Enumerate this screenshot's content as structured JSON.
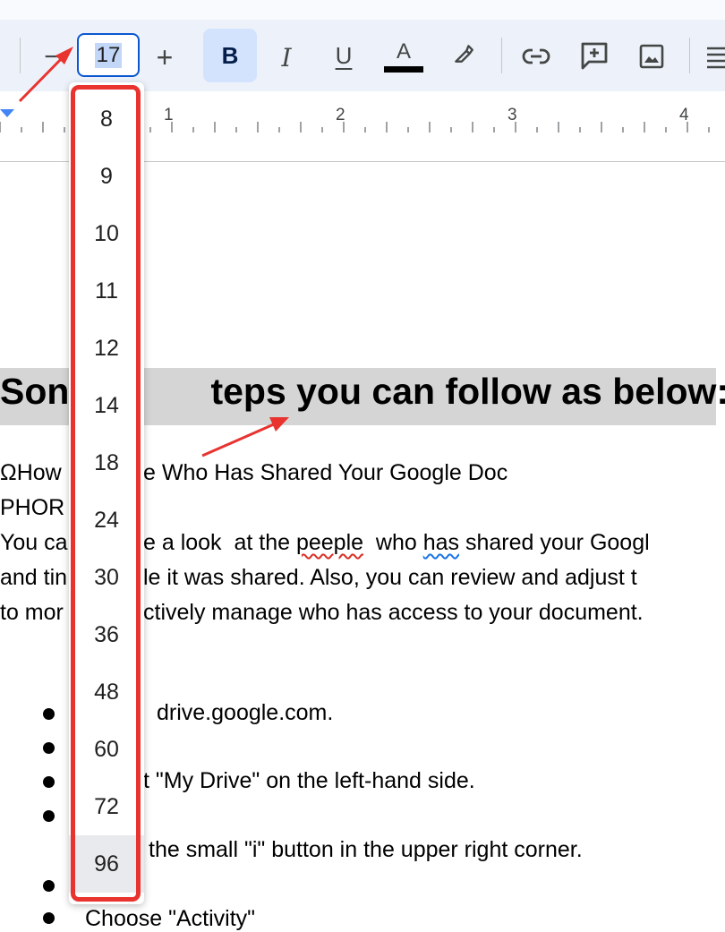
{
  "toolbar": {
    "font_size_value": "17",
    "decrease_glyph": "−",
    "increase_glyph": "+",
    "bold_label": "B",
    "italic_label": "I",
    "underline_label": "U",
    "text_color_label": "A",
    "text_color": "#000000"
  },
  "ruler": {
    "numbers": [
      "1",
      "2",
      "3",
      "4"
    ]
  },
  "font_size_dropdown": {
    "options": [
      "8",
      "9",
      "10",
      "11",
      "12",
      "14",
      "18",
      "24",
      "30",
      "36",
      "48",
      "60",
      "72",
      "96"
    ],
    "hovered": "96"
  },
  "document": {
    "heading": {
      "left": "Son",
      "right": "teps you can follow as below:"
    },
    "line1": {
      "left": "ΩHow",
      "right": "e Who Has Shared Your Google Doc"
    },
    "line2": {
      "left": "PHOR"
    },
    "para1": {
      "left": "You ca",
      "right_a": "e a look  at the ",
      "misspelled": "peeple",
      "right_b": "  who ",
      "grammar": "has",
      "right_c": " shared your Googl"
    },
    "para2": {
      "left": "and tin",
      "right": "le it was shared. Also, you can review and adjust t"
    },
    "para3": {
      "left": "to mor",
      "right": "ctively manage who has access to your document."
    },
    "bullets": [
      "drive.google.com.",
      "",
      "t \"My Drive\" on the left-hand side.",
      "",
      "the small \"i\" button in the upper right corner.",
      "",
      "Choose \"Activity\""
    ]
  },
  "colors": {
    "highlight_frame": "#e8332f",
    "toolbar_bg": "#edf2fa",
    "accent": "#0b57d0",
    "heading_bg": "#d5d5d5"
  }
}
